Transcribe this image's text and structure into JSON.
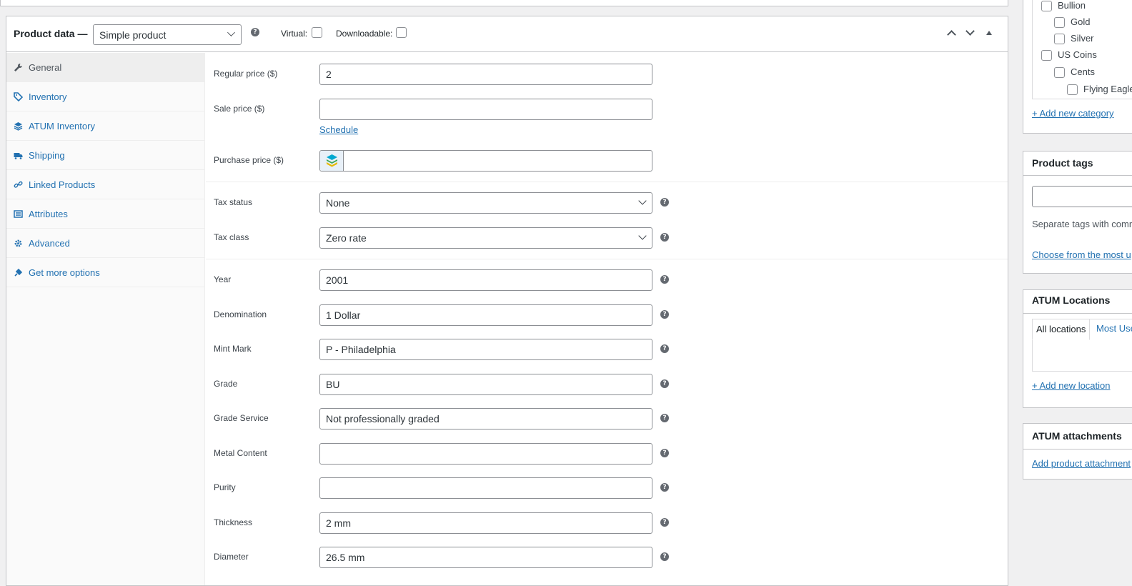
{
  "product_data": {
    "title": "Product data —",
    "type_value": "Simple product",
    "virtual_label": "Virtual:",
    "downloadable_label": "Downloadable:"
  },
  "tabs": [
    {
      "label": "General",
      "icon": "wrench-icon"
    },
    {
      "label": "Inventory",
      "icon": "tag-icon"
    },
    {
      "label": "ATUM Inventory",
      "icon": "layers-icon"
    },
    {
      "label": "Shipping",
      "icon": "truck-icon"
    },
    {
      "label": "Linked Products",
      "icon": "link-icon"
    },
    {
      "label": "Attributes",
      "icon": "list-icon"
    },
    {
      "label": "Advanced",
      "icon": "gear-icon"
    },
    {
      "label": "Get more options",
      "icon": "plugin-icon"
    }
  ],
  "pricing": {
    "regular_label": "Regular price ($)",
    "regular_value": "2",
    "sale_label": "Sale price ($)",
    "sale_value": "",
    "schedule_link": "Schedule",
    "purchase_label": "Purchase price ($)",
    "purchase_value": ""
  },
  "tax": {
    "status_label": "Tax status",
    "status_value": "None",
    "class_label": "Tax class",
    "class_value": "Zero rate"
  },
  "attributes": [
    {
      "label": "Year",
      "value": "2001"
    },
    {
      "label": "Denomination",
      "value": "1 Dollar"
    },
    {
      "label": "Mint Mark",
      "value": "P - Philadelphia"
    },
    {
      "label": "Grade",
      "value": "BU"
    },
    {
      "label": "Grade Service",
      "value": "Not professionally graded"
    },
    {
      "label": "Metal Content",
      "value": ""
    },
    {
      "label": "Purity",
      "value": ""
    },
    {
      "label": "Thickness",
      "value": "2 mm"
    },
    {
      "label": "Diameter",
      "value": "26.5 mm"
    }
  ],
  "categories": {
    "items": [
      "Bullion",
      "Gold",
      "Silver",
      "US Coins",
      "Cents",
      "Flying Eagle"
    ],
    "add_link": "+ Add new category"
  },
  "product_tags": {
    "title": "Product tags",
    "hint": "Separate tags with comm",
    "choose_link": "Choose from the most u"
  },
  "atum_locations": {
    "title": "ATUM Locations",
    "tab_all": "All locations",
    "tab_most": "Most Use",
    "add_link": "+ Add new location"
  },
  "atum_attachments": {
    "title": "ATUM attachments",
    "add_link": "Add product attachment"
  },
  "help_glyph": "?"
}
